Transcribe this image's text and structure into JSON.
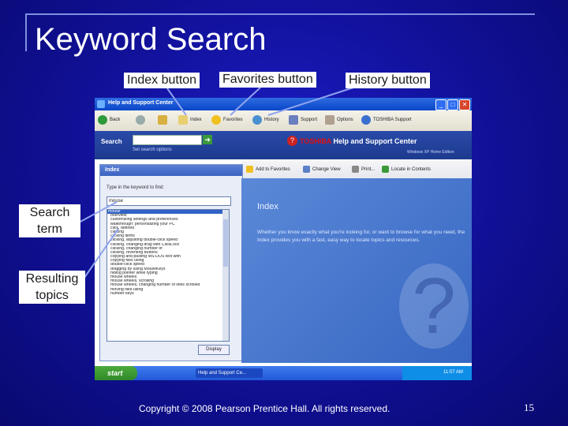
{
  "slide": {
    "title": "Keyword Search",
    "footer": "Copyright © 2008 Pearson Prentice Hall. All rights reserved.",
    "page_number": "15"
  },
  "callouts": {
    "index_button": "Index button",
    "favorites_button": "Favorites button",
    "history_button": "History button",
    "search_term_line1": "Search",
    "search_term_line2": "term",
    "resulting_topics_line1": "Resulting",
    "resulting_topics_line2": "topics"
  },
  "window": {
    "title": "Help and Support Center",
    "toolbar": [
      "Back",
      "Index",
      "Favorites",
      "History",
      "Support",
      "Options",
      "TOSHIBA Support"
    ],
    "search_label": "Search",
    "set_search_options": "Set search options",
    "brand_toshiba": "TOSHIBA",
    "brand_help": "Help and Support Center",
    "brand_sub": "Windows XP Home Edition",
    "right_toolbar": [
      "Add to Favorites",
      "Change View",
      "Print...",
      "Locate in Contents"
    ],
    "left_pane": {
      "heading": "Index",
      "prompt": "Type in the keyword to find:",
      "input_value": "mouse",
      "display_label": "Display",
      "items": [
        {
          "text": "mouse",
          "top": true
        },
        {
          "text": "overview"
        },
        {
          "text": "customizing settings and preferences"
        },
        {
          "text": "walkthrough: personalizing your PC"
        },
        {
          "text": "click, defined"
        },
        {
          "text": "clicking"
        },
        {
          "text": "clicking items"
        },
        {
          "text": "clicking, adjusting double-click speed"
        },
        {
          "text": "clicking, changing drag with ClickLock"
        },
        {
          "text": "clicking, changing number of"
        },
        {
          "text": "clicking, reversing buttons"
        },
        {
          "text": "copying and pasting MS-DOS text with"
        },
        {
          "text": "copying files using"
        },
        {
          "text": "double-click speed"
        },
        {
          "text": "dragging by using MouseKeys"
        },
        {
          "text": "hiding pointer while typing"
        },
        {
          "text": "mouse wheels"
        },
        {
          "text": "mouse wheels, scrolling"
        },
        {
          "text": "mouse wheels, changing number of lines scrolled"
        },
        {
          "text": "moving files using"
        },
        {
          "text": "number keys"
        }
      ]
    },
    "right_pane": {
      "title": "Index",
      "text": "Whether you know exactly what you're looking for, or want to browse for what you need, the Index provides you with a fast, easy way to locate topics and resources."
    },
    "taskbar": {
      "start": "start",
      "app": "Help and Support Ce...",
      "clock": "11:07 AM"
    }
  },
  "colors": {
    "slide_bg": "#12129e",
    "accent_line": "#7f8fe0",
    "arrow": "#8fa4ee"
  }
}
